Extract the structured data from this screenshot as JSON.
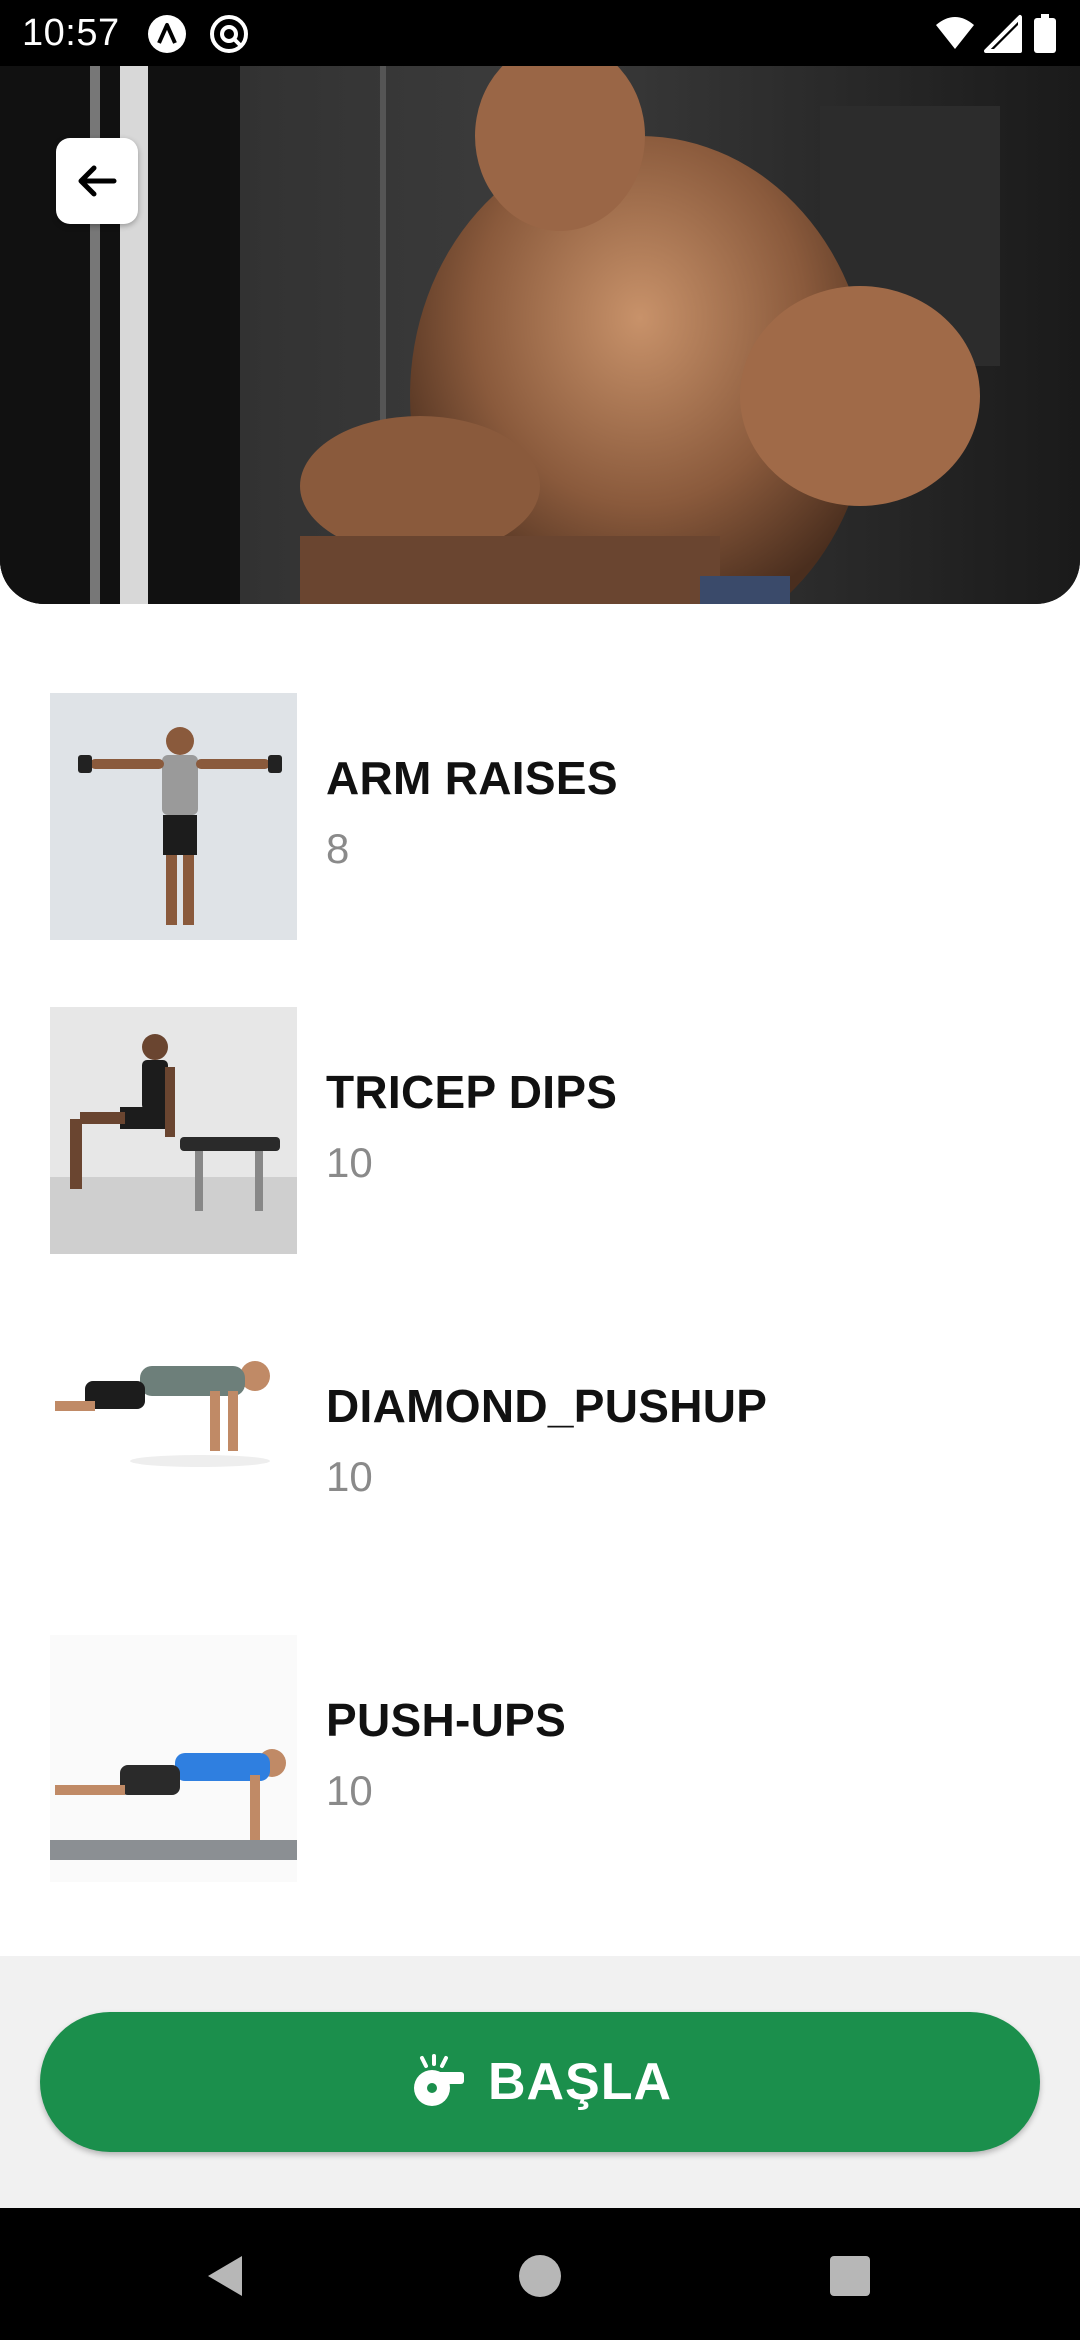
{
  "status_bar": {
    "time": "10:57",
    "icons": [
      "a-circle-icon",
      "at-circle-icon",
      "wifi-icon",
      "signal-icon",
      "battery-icon"
    ]
  },
  "hero": {
    "image": "muscular man doing cable curl in gym",
    "back_icon": "arrow-left-icon"
  },
  "exercises": [
    {
      "name": "ARM RAISES",
      "reps": "8",
      "thumb": "man doing lateral arm raises with dumbbells"
    },
    {
      "name": "TRICEP DIPS",
      "reps": "10",
      "thumb": "man doing tricep dips on a bench"
    },
    {
      "name": "DIAMOND_PUSHUP",
      "reps": "10",
      "thumb": "man doing diamond push-up"
    },
    {
      "name": "PUSH-UPS",
      "reps": "10",
      "thumb": "man doing push-up on mat"
    }
  ],
  "start_button": {
    "label": "BAŞLA",
    "icon": "whistle-icon"
  },
  "colors": {
    "accent": "#1b8f4c",
    "bottom_panel": "#f1f1f1",
    "reps_text": "#8a8a8a"
  },
  "nav_bar": {
    "buttons": [
      "back-triangle-icon",
      "home-circle-icon",
      "recents-square-icon"
    ]
  }
}
